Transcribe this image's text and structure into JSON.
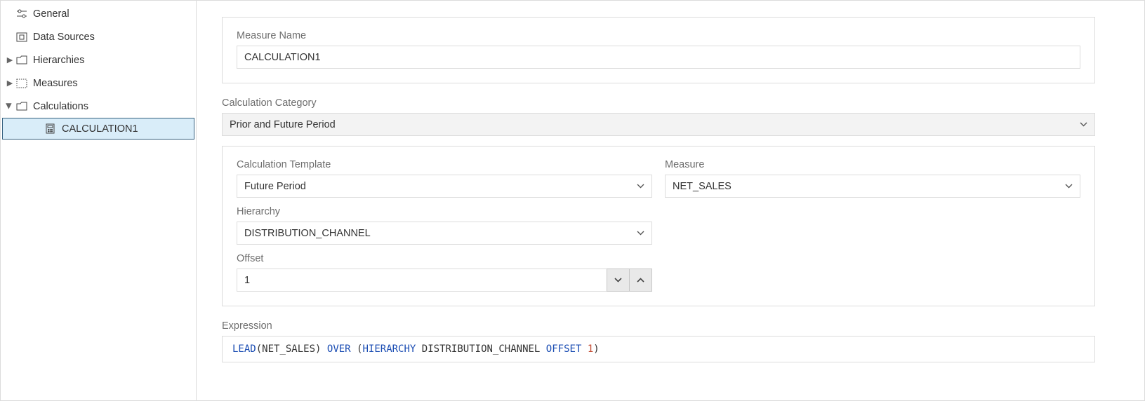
{
  "sidebar": {
    "items": [
      {
        "label": "General"
      },
      {
        "label": "Data Sources"
      },
      {
        "label": "Hierarchies"
      },
      {
        "label": "Measures"
      },
      {
        "label": "Calculations"
      }
    ],
    "selected_child": "CALCULATION1"
  },
  "form": {
    "measure_name": {
      "label": "Measure Name",
      "value": "CALCULATION1"
    },
    "calc_category": {
      "label": "Calculation Category",
      "value": "Prior and Future Period"
    },
    "calc_template": {
      "label": "Calculation Template",
      "value": "Future Period"
    },
    "measure": {
      "label": "Measure",
      "value": "NET_SALES"
    },
    "hierarchy": {
      "label": "Hierarchy",
      "value": "DISTRIBUTION_CHANNEL"
    },
    "offset": {
      "label": "Offset",
      "value": "1"
    },
    "expression": {
      "label": "Expression"
    }
  },
  "expression_tokens": {
    "lead": "LEAD",
    "lparen1": "(",
    "arg": "NET_SALES",
    "rparen1": ")",
    "sp1": " ",
    "over": "OVER",
    "sp2": " ",
    "lparen2": "(",
    "hierkw": "HIERARCHY",
    "sp3": " ",
    "hier": "DISTRIBUTION_CHANNEL",
    "sp4": " ",
    "offkw": "OFFSET",
    "sp5": " ",
    "offval": "1",
    "rparen2": ")"
  }
}
